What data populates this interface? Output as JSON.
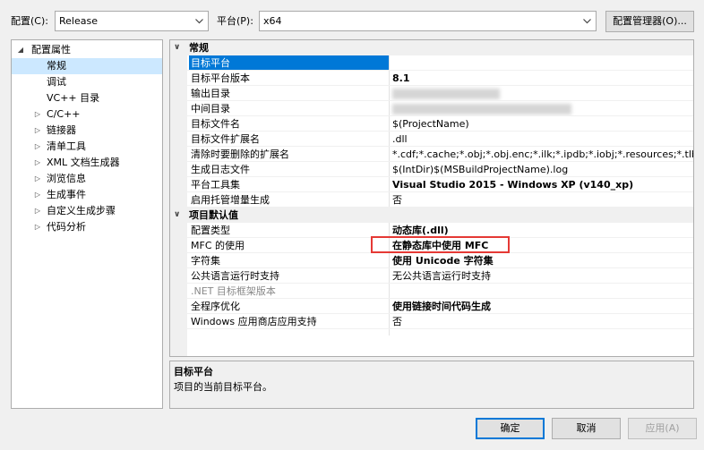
{
  "toolbar": {
    "config_label": "配置(C):",
    "config_value": "Release",
    "platform_label": "平台(P):",
    "platform_value": "x64",
    "config_manager_button": "配置管理器(O)..."
  },
  "tree": {
    "root": "配置属性",
    "items": [
      {
        "label": "常规",
        "expandable": false,
        "selected": true
      },
      {
        "label": "调试",
        "expandable": false
      },
      {
        "label": "VC++ 目录",
        "expandable": false
      },
      {
        "label": "C/C++",
        "expandable": true
      },
      {
        "label": "链接器",
        "expandable": true
      },
      {
        "label": "清单工具",
        "expandable": true
      },
      {
        "label": "XML 文档生成器",
        "expandable": true
      },
      {
        "label": "浏览信息",
        "expandable": true
      },
      {
        "label": "生成事件",
        "expandable": true
      },
      {
        "label": "自定义生成步骤",
        "expandable": true
      },
      {
        "label": "代码分析",
        "expandable": true
      }
    ]
  },
  "grid": {
    "categories": [
      {
        "name": "常规",
        "rows": [
          {
            "name": "目标平台",
            "value": "",
            "selected": true
          },
          {
            "name": "目标平台版本",
            "value": "8.1",
            "bold": true
          },
          {
            "name": "输出目录",
            "value": "",
            "redacted": true
          },
          {
            "name": "中间目录",
            "value": "",
            "redacted": true
          },
          {
            "name": "目标文件名",
            "value": "$(ProjectName)"
          },
          {
            "name": "目标文件扩展名",
            "value": ".dll"
          },
          {
            "name": "清除时要删除的扩展名",
            "value": "*.cdf;*.cache;*.obj;*.obj.enc;*.ilk;*.ipdb;*.iobj;*.resources;*.tlb;*.tli;*.t"
          },
          {
            "name": "生成日志文件",
            "value": "$(IntDir)$(MSBuildProjectName).log"
          },
          {
            "name": "平台工具集",
            "value": "Visual Studio 2015 - Windows XP (v140_xp)",
            "bold": true
          },
          {
            "name": "启用托管增量生成",
            "value": "否"
          }
        ]
      },
      {
        "name": "项目默认值",
        "rows": [
          {
            "name": "配置类型",
            "value": "动态库(.dll)",
            "bold": true
          },
          {
            "name": "MFC 的使用",
            "value": "在静态库中使用 MFC",
            "bold": true
          },
          {
            "name": "字符集",
            "value": "使用 Unicode 字符集",
            "bold": true
          },
          {
            "name": "公共语言运行时支持",
            "value": "无公共语言运行时支持"
          },
          {
            "name": ".NET 目标框架版本",
            "value": "",
            "dim": true
          },
          {
            "name": "全程序优化",
            "value": "使用链接时间代码生成",
            "bold": true
          },
          {
            "name": "Windows 应用商店应用支持",
            "value": "否"
          }
        ]
      }
    ]
  },
  "description": {
    "title": "目标平台",
    "text": "项目的当前目标平台。"
  },
  "buttons": {
    "ok": "确定",
    "cancel": "取消",
    "apply": "应用(A)"
  },
  "colors": {
    "selection": "#0078d7",
    "highlight_box": "#e53935",
    "tree_selection": "#cce8ff"
  }
}
